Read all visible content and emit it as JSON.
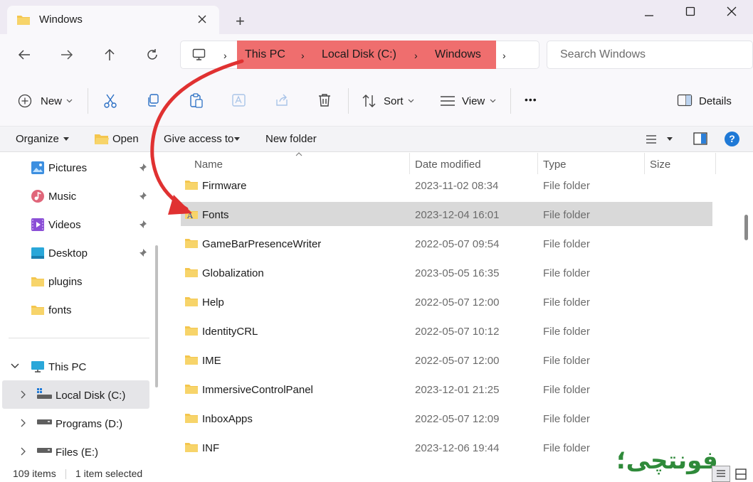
{
  "window": {
    "tab_title": "Windows",
    "new_tab_symbol": "+"
  },
  "address": {
    "crumbs": [
      "This PC",
      "Local Disk (C:)",
      "Windows"
    ],
    "separator": "›",
    "search_placeholder": "Search Windows"
  },
  "commands": {
    "new_label": "New",
    "sort_label": "Sort",
    "view_label": "View",
    "more_label": "•••",
    "details_label": "Details"
  },
  "legacy": {
    "organize": "Organize",
    "open": "Open",
    "give_access": "Give access to",
    "new_folder": "New folder",
    "help": "?"
  },
  "nav": {
    "items": [
      {
        "label": "Pictures",
        "icon": "pictures-icon",
        "pinned": true
      },
      {
        "label": "Music",
        "icon": "music-icon",
        "pinned": true
      },
      {
        "label": "Videos",
        "icon": "videos-icon",
        "pinned": true
      },
      {
        "label": "Desktop",
        "icon": "desktop-icon",
        "pinned": true
      },
      {
        "label": "plugins",
        "icon": "folder-icon",
        "pinned": false
      },
      {
        "label": "fonts",
        "icon": "folder-icon",
        "pinned": false
      }
    ],
    "this_pc": "This PC",
    "drives": [
      {
        "label": "Local Disk (C:)",
        "selected": true
      },
      {
        "label": "Programs (D:)",
        "selected": false
      },
      {
        "label": "Files (E:)",
        "selected": false
      }
    ]
  },
  "columns": {
    "name": "Name",
    "date": "Date modified",
    "type": "Type",
    "size": "Size"
  },
  "files": [
    {
      "name": "Firmware",
      "date": "2023-11-02 08:34",
      "type": "File folder",
      "icon": "folder-icon"
    },
    {
      "name": "Fonts",
      "date": "2023-12-04 16:01",
      "type": "File folder",
      "icon": "fonts-folder-icon",
      "selected": true
    },
    {
      "name": "GameBarPresenceWriter",
      "date": "2022-05-07 09:54",
      "type": "File folder",
      "icon": "folder-icon"
    },
    {
      "name": "Globalization",
      "date": "2023-05-05 16:35",
      "type": "File folder",
      "icon": "folder-icon"
    },
    {
      "name": "Help",
      "date": "2022-05-07 12:00",
      "type": "File folder",
      "icon": "folder-icon"
    },
    {
      "name": "IdentityCRL",
      "date": "2022-05-07 10:12",
      "type": "File folder",
      "icon": "folder-icon"
    },
    {
      "name": "IME",
      "date": "2022-05-07 12:00",
      "type": "File folder",
      "icon": "folder-icon"
    },
    {
      "name": "ImmersiveControlPanel",
      "date": "2023-12-01 21:25",
      "type": "File folder",
      "icon": "folder-icon"
    },
    {
      "name": "InboxApps",
      "date": "2022-05-07 12:09",
      "type": "File folder",
      "icon": "folder-icon"
    },
    {
      "name": "INF",
      "date": "2023-12-06 19:44",
      "type": "File folder",
      "icon": "folder-icon"
    }
  ],
  "status": {
    "items_count": "109 items",
    "selected": "1 item selected",
    "watermark": "فونتچی؛"
  },
  "colors": {
    "crumb_highlight": "#ef6e6e",
    "annotation_arrow": "#e03131",
    "folder": "#f4c64e",
    "watermark": "#2f8a3a"
  }
}
